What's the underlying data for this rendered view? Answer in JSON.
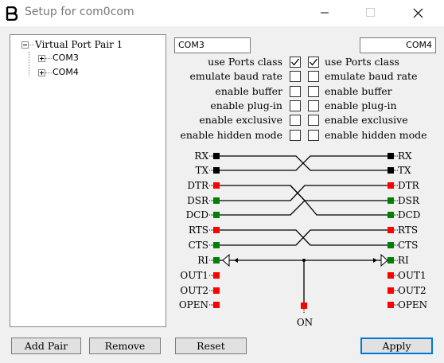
{
  "window": {
    "title": "Setup for com0com"
  },
  "tree": {
    "root_label": "Virtual Port Pair 1",
    "children": [
      {
        "label": "COM3"
      },
      {
        "label": "COM4"
      }
    ]
  },
  "ports": {
    "left_name": "COM3",
    "right_name": "COM4"
  },
  "options": [
    {
      "label": "use Ports class",
      "left_checked": true,
      "right_checked": true
    },
    {
      "label": "emulate baud rate",
      "left_checked": false,
      "right_checked": false
    },
    {
      "label": "enable buffer",
      "left_checked": false,
      "right_checked": false
    },
    {
      "label": "enable plug-in",
      "left_checked": false,
      "right_checked": false
    },
    {
      "label": "enable exclusive",
      "left_checked": false,
      "right_checked": false
    },
    {
      "label": "enable hidden mode",
      "left_checked": false,
      "right_checked": false
    }
  ],
  "signals_left": [
    "RX",
    "TX",
    "DTR",
    "DSR",
    "DCD",
    "RTS",
    "CTS",
    "RI",
    "OUT1",
    "OUT2",
    "OPEN"
  ],
  "signals_right": [
    "RX",
    "TX",
    "DTR",
    "DSR",
    "DCD",
    "RTS",
    "CTS",
    "RI",
    "OUT1",
    "OUT2",
    "OPEN"
  ],
  "on_label": "ON",
  "buttons": {
    "add_pair": "Add Pair",
    "remove": "Remove",
    "reset": "Reset",
    "apply": "Apply"
  },
  "colors": {
    "input_pin": "#008000",
    "output_pin": "#ff0000",
    "data_pin": "#000000",
    "default_button_border": "#0078d7"
  },
  "icons": {
    "app": "com0com-logo-icon",
    "minimize": "minimize-icon",
    "maximize": "maximize-icon",
    "close": "close-icon"
  }
}
